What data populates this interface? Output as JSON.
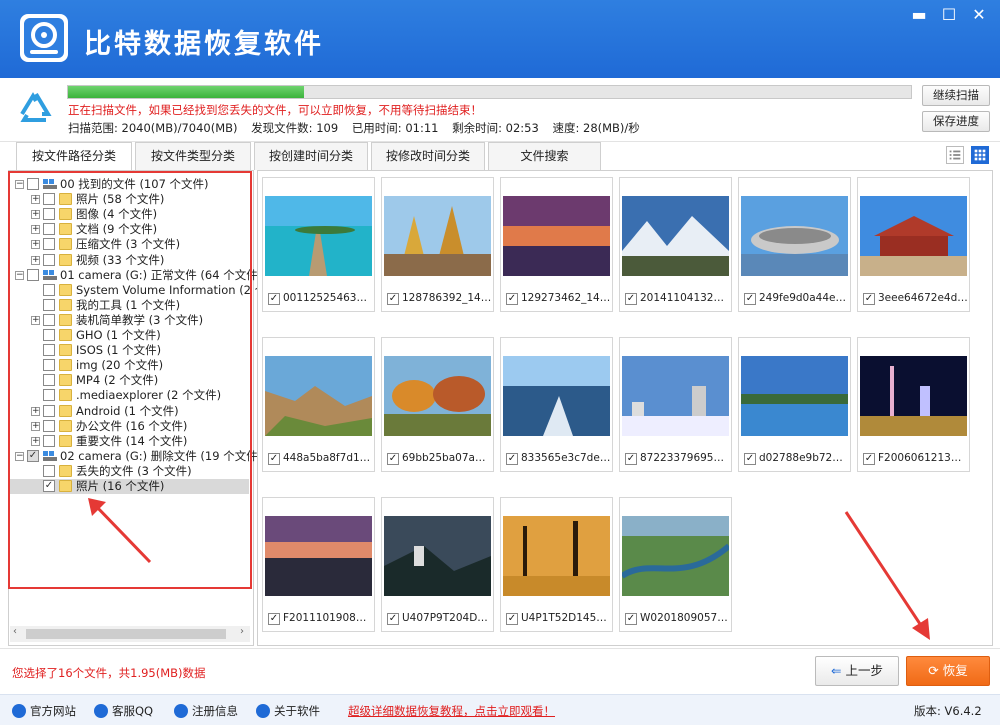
{
  "app": {
    "title": "比特数据恢复软件"
  },
  "window": {
    "minimize": "▬",
    "maximize": "☐",
    "close": "✕"
  },
  "scan": {
    "progress": 0.28,
    "message": "正在扫描文件，如果已经找到您丢失的文件，可以立即恢复，不用等待扫描结束！",
    "range": "扫描范围: 2040(MB)/7040(MB)",
    "found": "发现文件数: 109",
    "elapsed": "已用时间: 01:11",
    "remaining": "剩余时间: 02:53",
    "speed": "速度: 28(MB)/秒",
    "continue_label": "继续扫描",
    "save_label": "保存进度"
  },
  "tabs": [
    "按文件路径分类",
    "按文件类型分类",
    "按创建时间分类",
    "按修改时间分类",
    "文件搜索"
  ],
  "tree": [
    {
      "label": "00 找到的文件  (107 个文件)",
      "level": 0,
      "type": "drive",
      "exp": "⊟",
      "check": ""
    },
    {
      "label": "照片    (58 个文件)",
      "level": 1,
      "type": "folder",
      "exp": "⊞",
      "check": ""
    },
    {
      "label": "图像    (4 个文件)",
      "level": 1,
      "type": "folder",
      "exp": "⊞",
      "check": ""
    },
    {
      "label": "文档    (9 个文件)",
      "level": 1,
      "type": "folder",
      "exp": "⊞",
      "check": ""
    },
    {
      "label": "压缩文件   (3 个文件)",
      "level": 1,
      "type": "folder",
      "exp": "⊞",
      "check": ""
    },
    {
      "label": "视频    (33 个文件)",
      "level": 1,
      "type": "folder",
      "exp": "⊞",
      "check": ""
    },
    {
      "label": "01 camera (G:) 正常文件 (64 个文件)",
      "level": 0,
      "type": "drive",
      "exp": "⊟",
      "check": ""
    },
    {
      "label": "System Volume Information   (2 个文",
      "level": 1,
      "type": "folder",
      "exp": "",
      "check": ""
    },
    {
      "label": "我的工具   (1 个文件)",
      "level": 1,
      "type": "folder",
      "exp": "",
      "check": ""
    },
    {
      "label": "装机简单教学   (3 个文件)",
      "level": 1,
      "type": "folder",
      "exp": "⊞",
      "check": ""
    },
    {
      "label": "GHO    (1 个文件)",
      "level": 1,
      "type": "folder",
      "exp": "",
      "check": ""
    },
    {
      "label": "ISOS    (1 个文件)",
      "level": 1,
      "type": "folder",
      "exp": "",
      "check": ""
    },
    {
      "label": "img    (20 个文件)",
      "level": 1,
      "type": "folder",
      "exp": "",
      "check": ""
    },
    {
      "label": "MP4    (2 个文件)",
      "level": 1,
      "type": "folder",
      "exp": "",
      "check": ""
    },
    {
      "label": ".mediaexplorer    (2 个文件)",
      "level": 1,
      "type": "folder",
      "exp": "",
      "check": ""
    },
    {
      "label": "Android    (1 个文件)",
      "level": 1,
      "type": "folder",
      "exp": "⊞",
      "check": ""
    },
    {
      "label": "办公文件    (16 个文件)",
      "level": 1,
      "type": "folder",
      "exp": "⊞",
      "check": ""
    },
    {
      "label": "重要文件    (14 个文件)",
      "level": 1,
      "type": "folder",
      "exp": "⊞",
      "check": ""
    },
    {
      "label": "02 camera (G:) 删除文件 (19 个文件)",
      "level": 0,
      "type": "drive",
      "exp": "⊟",
      "check": "partial"
    },
    {
      "label": "丢失的文件    (3 个文件)",
      "level": 1,
      "type": "folder",
      "exp": "",
      "check": ""
    },
    {
      "label": "照片    (16 个文件)",
      "level": 1,
      "type": "folder",
      "exp": "",
      "check": "✓",
      "selected": true
    }
  ],
  "files": [
    {
      "name": "00112525463508...",
      "scene": "pier"
    },
    {
      "name": "128786392_1457...",
      "scene": "temple"
    },
    {
      "name": "129273462_1473...",
      "scene": "sunset"
    },
    {
      "name": "20141104132350...",
      "scene": "mountain"
    },
    {
      "name": "249fe9d0a44e4d...",
      "scene": "stadium"
    },
    {
      "name": "3eee64672e4d42...",
      "scene": "palace"
    },
    {
      "name": "448a5ba8f7d119...",
      "scene": "canyon"
    },
    {
      "name": "69bb25ba07a74b...",
      "scene": "autumn"
    },
    {
      "name": "833565e3c7de48...",
      "scene": "sea"
    },
    {
      "name": "87223379695800...",
      "scene": "snowcity"
    },
    {
      "name": "d02788e9b72b16...",
      "scene": "lake"
    },
    {
      "name": "F2006061213423...",
      "scene": "night"
    },
    {
      "name": "F2011101908345...",
      "scene": "dusk"
    },
    {
      "name": "U407P9T204D247...",
      "scene": "castle"
    },
    {
      "name": "U4P1T52D145F10...",
      "scene": "forest"
    },
    {
      "name": "W020180905726...",
      "scene": "river"
    }
  ],
  "bottom": {
    "selected_info": "您选择了16个文件，共1.95(MB)数据",
    "prev_label": "上一步",
    "recover_label": "恢复"
  },
  "footer": {
    "site": "官方网站",
    "qq": "客服QQ",
    "register": "注册信息",
    "about": "关于软件",
    "tutorial_link": "超级详细数据恢复教程，点击立即观看！",
    "version": "版本: V6.4.2"
  },
  "colors": {
    "titlebar": "#1f6ad6",
    "alert": "#e02020",
    "recover": "#f06a16"
  }
}
